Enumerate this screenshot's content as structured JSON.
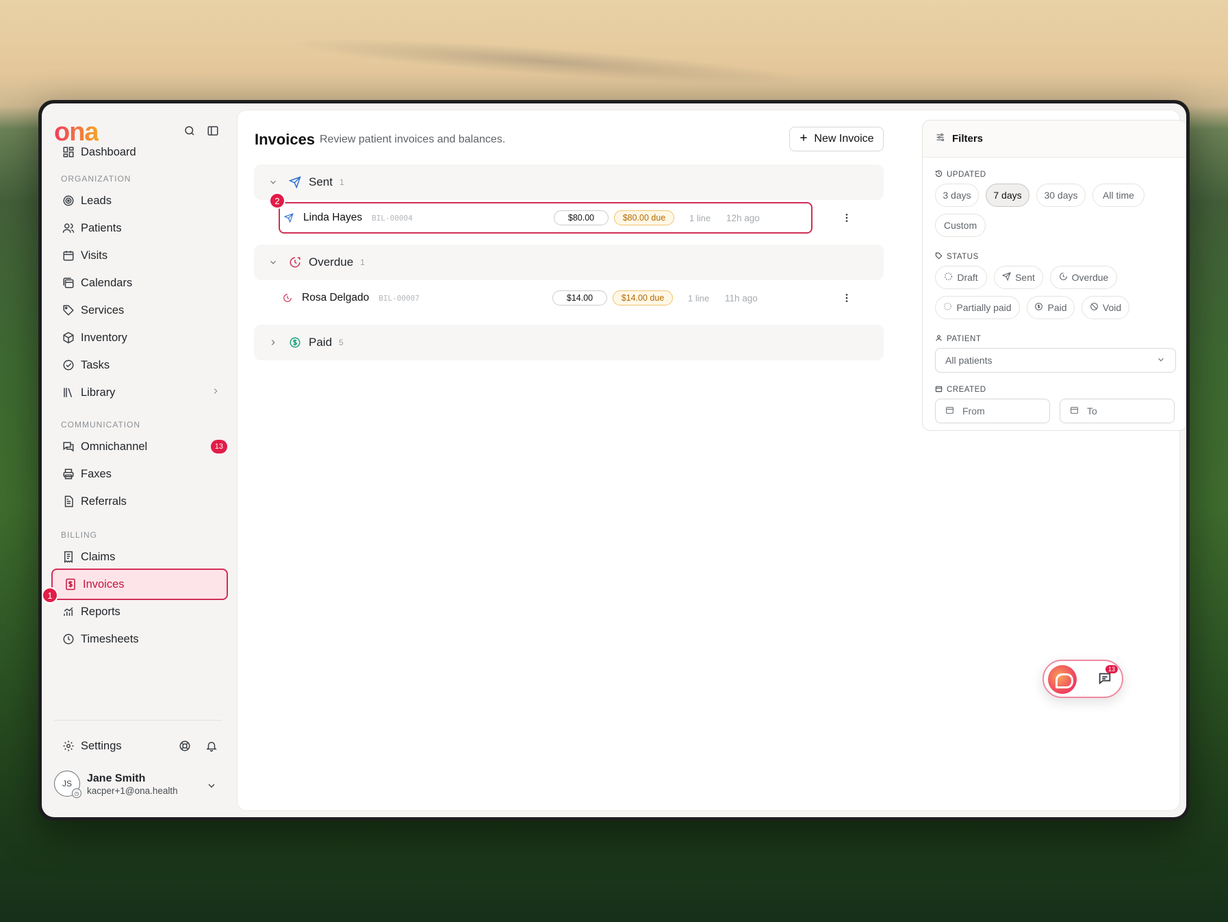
{
  "app": {
    "logo": "ona"
  },
  "sidebar": {
    "dashboard": "Dashboard",
    "sections": {
      "organization": "ORGANIZATION",
      "communication": "COMMUNICATION",
      "billing": "BILLING"
    },
    "organization": [
      "Leads",
      "Patients",
      "Visits",
      "Calendars",
      "Services",
      "Inventory",
      "Tasks",
      "Library"
    ],
    "communication": [
      "Omnichannel",
      "Faxes",
      "Referrals"
    ],
    "omnichannel_badge": "13",
    "billing": [
      "Claims",
      "Invoices",
      "Reports",
      "Timesheets"
    ],
    "settings": "Settings",
    "user": {
      "initials": "JS",
      "name": "Jane Smith",
      "email": "kacper+1@ona.health"
    }
  },
  "markers": {
    "one": "1",
    "two": "2"
  },
  "main": {
    "title": "Invoices",
    "subtitle": "Review patient invoices and balances.",
    "new_button": "New Invoice",
    "groups": {
      "sent": {
        "label": "Sent",
        "count": "1"
      },
      "overdue": {
        "label": "Overdue",
        "count": "1"
      },
      "paid": {
        "label": "Paid",
        "count": "5"
      }
    },
    "rows": [
      {
        "name": "Linda Hayes",
        "code": "BIL-00004",
        "amount": "$80.00",
        "due": "$80.00 due",
        "lines": "1 line",
        "ago": "12h ago"
      },
      {
        "name": "Rosa Delgado",
        "code": "BIL-00007",
        "amount": "$14.00",
        "due": "$14.00 due",
        "lines": "1 line",
        "ago": "11h ago"
      }
    ]
  },
  "filters": {
    "title": "Filters",
    "updated_label": "UPDATED",
    "updated": [
      "3 days",
      "7 days",
      "30 days",
      "All time",
      "Custom"
    ],
    "updated_selected": "7 days",
    "status_label": "STATUS",
    "status": [
      "Draft",
      "Sent",
      "Overdue",
      "Partially paid",
      "Paid",
      "Void"
    ],
    "patient_label": "PATIENT",
    "patient_value": "All patients",
    "created_label": "CREATED",
    "from": "From",
    "to": "To"
  },
  "widget": {
    "badge": "13"
  },
  "colors": {
    "accent": "#e11d48",
    "sent": "#2f6fd0",
    "overdue": "#d02f57",
    "paid": "#1aa37a"
  }
}
